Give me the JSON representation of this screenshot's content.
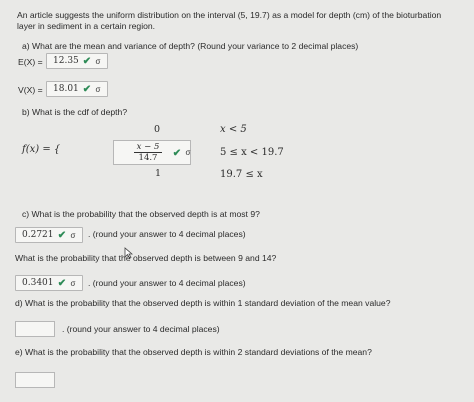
{
  "intro": "An article suggests the uniform distribution on the interval (5, 19.7) as a model for depth (cm) of the bioturbation layer in sediment in a certain region.",
  "qa": {
    "text": "a) What are the mean and variance of depth? (Round your variance to 2 decimal places)",
    "ex_label": "E(X) =",
    "ex_value": "12.35",
    "vx_label": "V(X) =",
    "vx_value": "18.01"
  },
  "qb": {
    "text": "b) What is the cdf of depth?",
    "f_label": "f(x) = {",
    "zero": "0",
    "frac_num": "x − 5",
    "frac_den": "14.7",
    "one": "1",
    "cond1": "x < 5",
    "cond2": "5 ≤ x < 19.7",
    "cond3": "19.7 ≤ x"
  },
  "qc": {
    "text": "c) What is the probability that the observed depth is at most 9?",
    "value": "0.2721",
    "suffix": ". (round your answer to 4 decimal places)",
    "text2": "What is the probability that the observed depth is between 9 and 14?",
    "value2": "0.3401",
    "suffix2": ". (round your answer to 4 decimal places)"
  },
  "qd": {
    "text": "d) What is the probability that the observed depth is within 1 standard deviation of the mean value?",
    "value": "",
    "suffix": ". (round your answer to 4 decimal places)"
  },
  "qe": {
    "text": "e) What is the probability that the observed depth is within 2 standard deviations of the mean?",
    "value": ""
  },
  "icons": {
    "check": "✔",
    "key": "σ"
  },
  "colors": {
    "background": "#e9e9e7",
    "check": "#2e8b57"
  }
}
